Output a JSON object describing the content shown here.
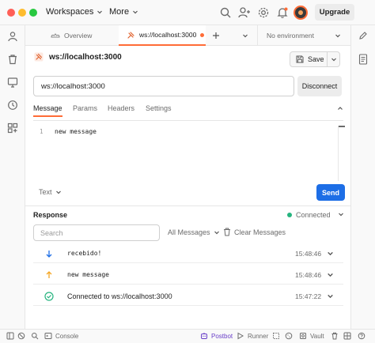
{
  "titlebar": {
    "workspaces_label": "Workspaces",
    "more_label": "More",
    "upgrade_label": "Upgrade"
  },
  "tabs": {
    "overview_label": "Overview",
    "active_tab_label": "ws://localhost:3000",
    "environment_label": "No environment"
  },
  "request": {
    "title": "ws://localhost:3000",
    "save_label": "Save",
    "url_value": "ws://localhost:3000",
    "disconnect_label": "Disconnect",
    "subtabs": [
      "Message",
      "Params",
      "Headers",
      "Settings"
    ],
    "editor_line_number": "1",
    "editor_content": "new message",
    "format_label": "Text",
    "send_label": "Send"
  },
  "response": {
    "title": "Response",
    "connection_status": "Connected",
    "search_placeholder": "Search",
    "filter_label": "All Messages",
    "clear_label": "Clear Messages",
    "messages": [
      {
        "direction": "received",
        "text": "recebido!",
        "time": "15:48:46"
      },
      {
        "direction": "sent",
        "text": "new message",
        "time": "15:48:46"
      },
      {
        "direction": "connected",
        "text": "Connected to ws://localhost:3000",
        "time": "15:47:22"
      }
    ]
  },
  "statusbar": {
    "console_label": "Console",
    "postbot_label": "Postbot",
    "runner_label": "Runner",
    "vault_label": "Vault"
  },
  "colors": {
    "accent": "#ff6c37",
    "send_button": "#1d6ee6",
    "connected_green": "#26b47f",
    "received_arrow": "#1d6ee6",
    "sent_arrow": "#f5a623"
  }
}
